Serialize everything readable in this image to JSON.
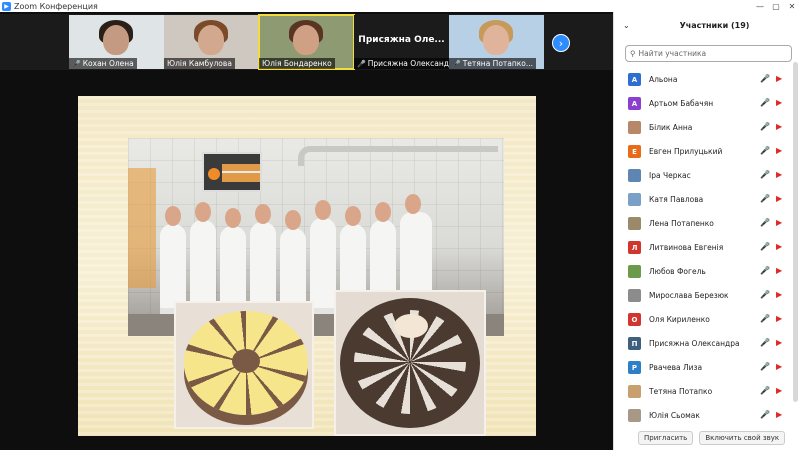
{
  "window": {
    "title": "Zoom Конференция",
    "minimize": "—",
    "maximize": "▢",
    "close": "✕"
  },
  "thumbnails": [
    {
      "name": "Кохан Олена",
      "muted": true,
      "face_color": "#c49a82",
      "hair_color": "#2a2018",
      "bg": "#dfe4e6",
      "active": false
    },
    {
      "name": "Юлія Камбулова",
      "muted": false,
      "face_color": "#d2a88e",
      "hair_color": "#7a4a2a",
      "bg": "#cfc8c0",
      "active": false
    },
    {
      "name": "Юлія Бондаренко",
      "muted": false,
      "face_color": "#d0a085",
      "hair_color": "#5a3422",
      "bg": "#8d9a72",
      "active": true
    },
    {
      "name": "Присяжна Олександр...",
      "bigname": "Присяжна Оле...",
      "muted": true,
      "active": false
    },
    {
      "name": "Тетяна Потапко...",
      "muted": true,
      "face_color": "#e0b49a",
      "hair_color": "#c79a5a",
      "bg": "#b8d0e6",
      "active": false
    }
  ],
  "participants_panel": {
    "title": "Участники (19)",
    "search_placeholder": "Найти участника",
    "participants": [
      {
        "name": "Альона",
        "initial": "A",
        "color": "#2d6fd0"
      },
      {
        "name": "Артьом Бабачян",
        "initial": "A",
        "color": "#8a3fd0"
      },
      {
        "name": "Білик Анна",
        "initial": "",
        "color": "#b7876a"
      },
      {
        "name": "Евген Прилуцький",
        "initial": "E",
        "color": "#e86b1a"
      },
      {
        "name": "Іра Черкас",
        "initial": "",
        "color": "#5f86b3"
      },
      {
        "name": "Катя Павлова",
        "initial": "",
        "color": "#7aa0c8"
      },
      {
        "name": "Лена Потапенко",
        "initial": "",
        "color": "#9b8a6a"
      },
      {
        "name": "Литвинова Евгенія",
        "initial": "Л",
        "color": "#d0362e"
      },
      {
        "name": "Любов Фогель",
        "initial": "",
        "color": "#6b9a4a"
      },
      {
        "name": "Мирослава Березюк",
        "initial": "",
        "color": "#8c8c8c"
      },
      {
        "name": "Оля Кириленко",
        "initial": "O",
        "color": "#d0362e"
      },
      {
        "name": "Присяжна Олександра",
        "initial": "П",
        "color": "#3e5f7e"
      },
      {
        "name": "Рвачева Лиза",
        "initial": "P",
        "color": "#2d80c8"
      },
      {
        "name": "Тетяна Потапко",
        "initial": "",
        "color": "#c8a070"
      },
      {
        "name": "Юлія Сьомак",
        "initial": "",
        "color": "#a89888"
      }
    ],
    "invite_label": "Пригласить",
    "unmute_label": "Включить свой звук"
  }
}
